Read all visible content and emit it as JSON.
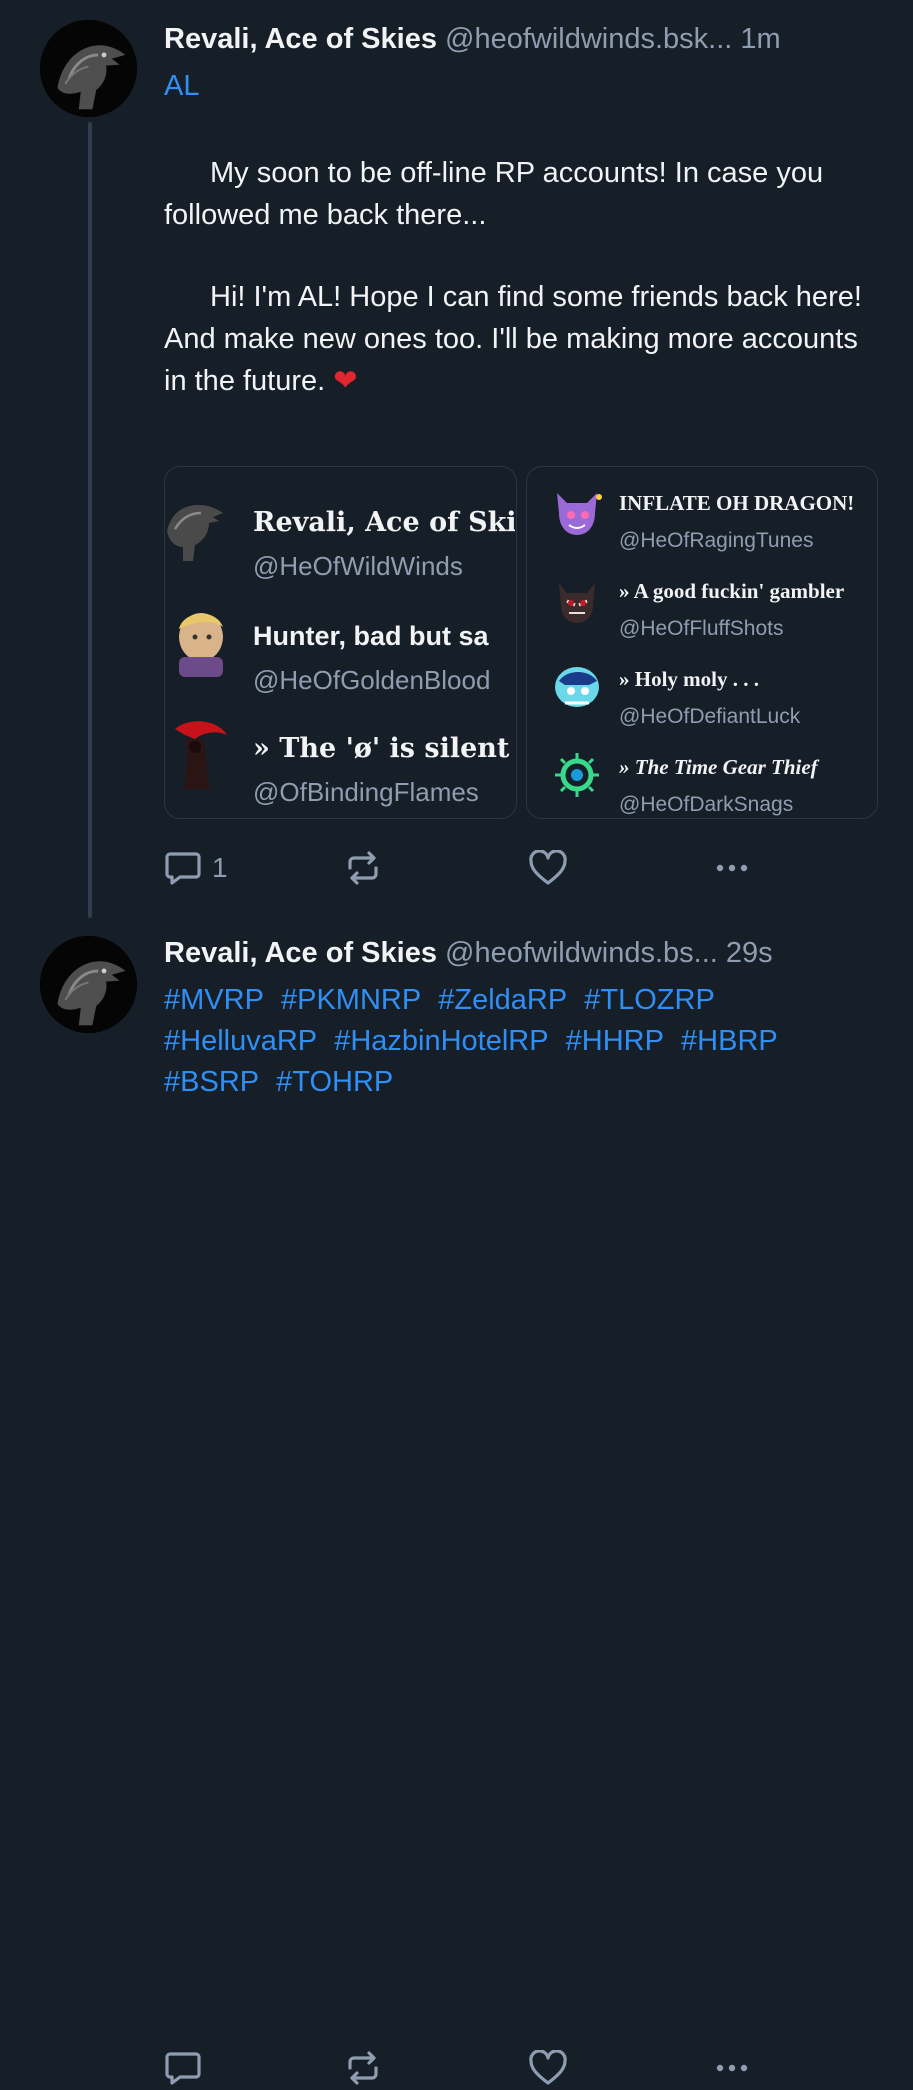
{
  "posts": [
    {
      "author": {
        "display_name": "Revali, Ace of Skies",
        "handle": "@heofwildwinds.bsk...",
        "time": "1m"
      },
      "reply_label": "AL",
      "paragraphs": [
        "My soon to be off-line RP accounts! In case you followed me back there...",
        "Hi! I'm AL! Hope I can find some friends back here! And make new ones too. I'll be making more accounts in the future."
      ],
      "emoji": "❤",
      "embed": {
        "left": [
          {
            "name": "Revali, Ace of Skie",
            "handle": "@HeOfWildWinds"
          },
          {
            "name": "Hunter, bad but sa",
            "handle": "@HeOfGoldenBlood"
          },
          {
            "name": "» The 'ø' is silent !",
            "handle": "@OfBindingFlames"
          }
        ],
        "right": [
          {
            "name": "INFLATE OH DRAGON!",
            "handle": "@HeOfRagingTunes"
          },
          {
            "name": "» A good fuckin' gambler",
            "handle": "@HeOfFluffShots"
          },
          {
            "name": "» Holy moly . . .",
            "handle": "@HeOfDefiantLuck"
          },
          {
            "name": "» The Time Gear Thief",
            "handle": "@HeOfDarkSnags"
          }
        ]
      },
      "actions": {
        "reply_count": "1",
        "reply_icon": "comment-icon",
        "repost_icon": "repost-icon",
        "like_icon": "heart-icon",
        "more_icon": "more-icon"
      }
    },
    {
      "author": {
        "display_name": "Revali, Ace of Skies",
        "handle": "@heofwildwinds.bs...",
        "time": "29s"
      },
      "hashtags": [
        "#MVRP",
        "#PKMNRP",
        "#ZeldaRP",
        "#TLOZRP",
        "#HelluvaRP",
        "#HazbinHotelRP",
        "#HHRP",
        "#HBRP",
        "#BSRP",
        "#TOHRP"
      ],
      "actions": {
        "reply_count": "",
        "reply_icon": "comment-icon",
        "repost_icon": "repost-icon",
        "like_icon": "heart-icon",
        "more_icon": "more-icon"
      }
    }
  ],
  "colors": {
    "background": "#161e27",
    "text": "#f1f3f5",
    "muted": "#8f9db0",
    "link": "#2f8ff5",
    "heart": "#e0262f"
  }
}
